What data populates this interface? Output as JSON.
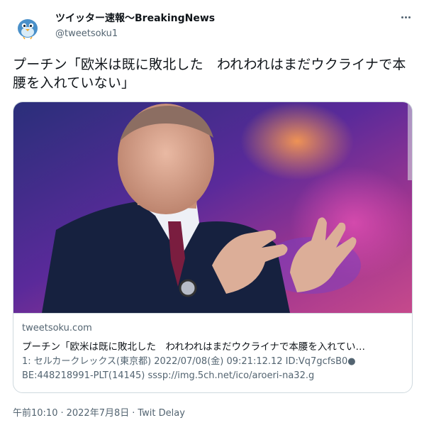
{
  "author": {
    "display_name": "ツイッター速報〜BreakingNews",
    "handle": "@tweetsoku1"
  },
  "tweet": {
    "text": "プーチン「欧米は既に敗北した　われわれはまだウクライナで本腰を入れていない」"
  },
  "card": {
    "domain": "tweetsoku.com",
    "title": "プーチン「欧米は既に敗北した　われわれはまだウクライナで本腰を入れてい…",
    "description": "1: セルカークレックス(東京都) 2022/07/08(金) 09:21:12.12 ID:Vq7gcfsB0● BE:448218991-PLT(14145) sssp://img.5ch.net/ico/aroeri-na32.g"
  },
  "footer": {
    "time": "午前10:10",
    "date": "2022年7月8日",
    "source": "Twit Delay",
    "separator": "·"
  },
  "icons": {
    "avatar": "bird-avatar-icon",
    "more": "more-options-icon"
  },
  "colors": {
    "text_primary": "#0f1419",
    "text_secondary": "#536471",
    "border": "#cfd9de",
    "avatar_bird": "#4a90c9"
  }
}
